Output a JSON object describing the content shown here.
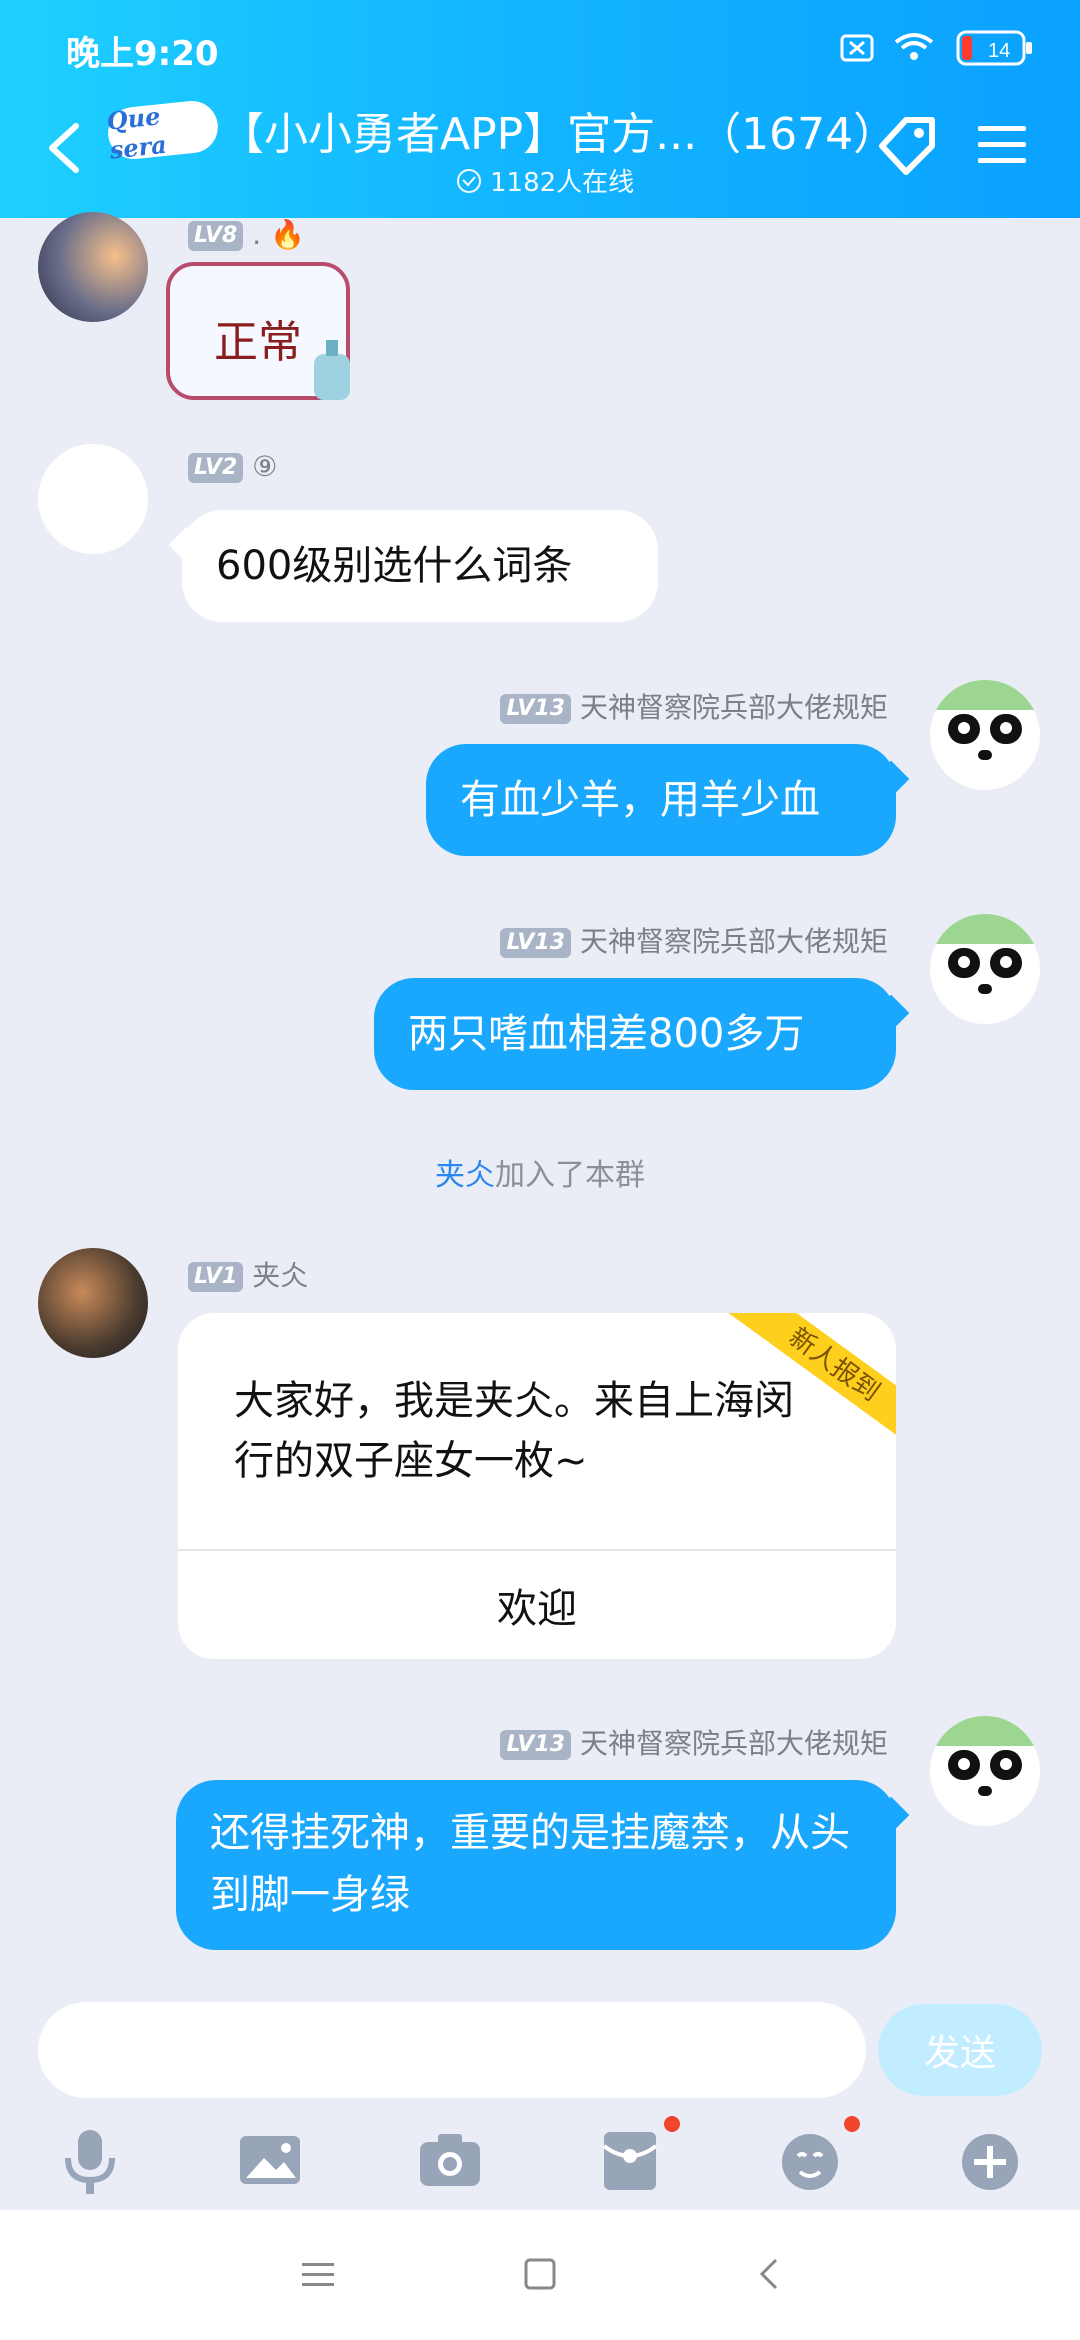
{
  "status": {
    "time": "晚上9:20",
    "battery": "14"
  },
  "header": {
    "logo_text": "Que sera",
    "title": "【小小勇者APP】官方...（1674）",
    "online": "1182人在线"
  },
  "messages": [
    {
      "side": "left",
      "level": "LV8",
      "name": ".",
      "sticker_text": "正常"
    },
    {
      "side": "left",
      "level": "LV2",
      "name": "⑨",
      "text": "600级别选什么词条"
    },
    {
      "side": "right",
      "level": "LV13",
      "name": "天神督察院兵部大佬规矩",
      "text": "有血少羊，用羊少血"
    },
    {
      "side": "right",
      "level": "LV13",
      "name": "天神督察院兵部大佬规矩",
      "text": "两只嗜血相差800多万"
    },
    {
      "side": "right",
      "level": "LV13",
      "name": "天神督察院兵部大佬规矩",
      "text": "还得挂死神，重要的是挂魔禁，从头到脚一身绿"
    }
  ],
  "system_note": {
    "user": "夹仌",
    "text": "加入了本群"
  },
  "welcome": {
    "level": "LV1",
    "name": "夹仌",
    "ribbon": "新人报到",
    "text": "大家好，我是夹仌。来自上海闵行的双子座女一枚~",
    "action": "欢迎"
  },
  "input": {
    "placeholder": "",
    "send_label": "发送"
  },
  "toolbar": [
    "mic-icon",
    "image-icon",
    "camera-icon",
    "redpacket-icon",
    "emoji-icon",
    "plus-icon"
  ],
  "colors": {
    "header_start": "#1fd0ff",
    "header_end": "#0aa1ff",
    "bubble_right": "#1aa8ff",
    "bg": "#eaedf5"
  }
}
